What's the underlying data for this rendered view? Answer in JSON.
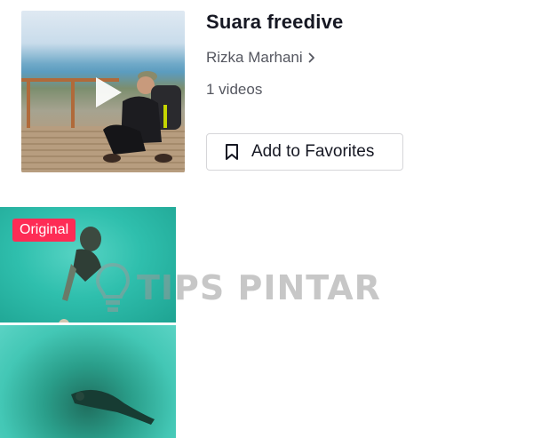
{
  "sound": {
    "title": "Suara freedive",
    "author": "Rizka Marhani",
    "video_count": "1 videos",
    "favorite_label": "Add to Favorites"
  },
  "cover": {
    "icon": "play-icon"
  },
  "videos": [
    {
      "badge": "Original"
    },
    {
      "badge": ""
    }
  ],
  "watermark": {
    "text": "TIPS PINTAR"
  },
  "colors": {
    "badge": "#fe2c55",
    "text_primary": "#161823",
    "text_secondary": "#555760",
    "border": "#d6d6d9"
  }
}
